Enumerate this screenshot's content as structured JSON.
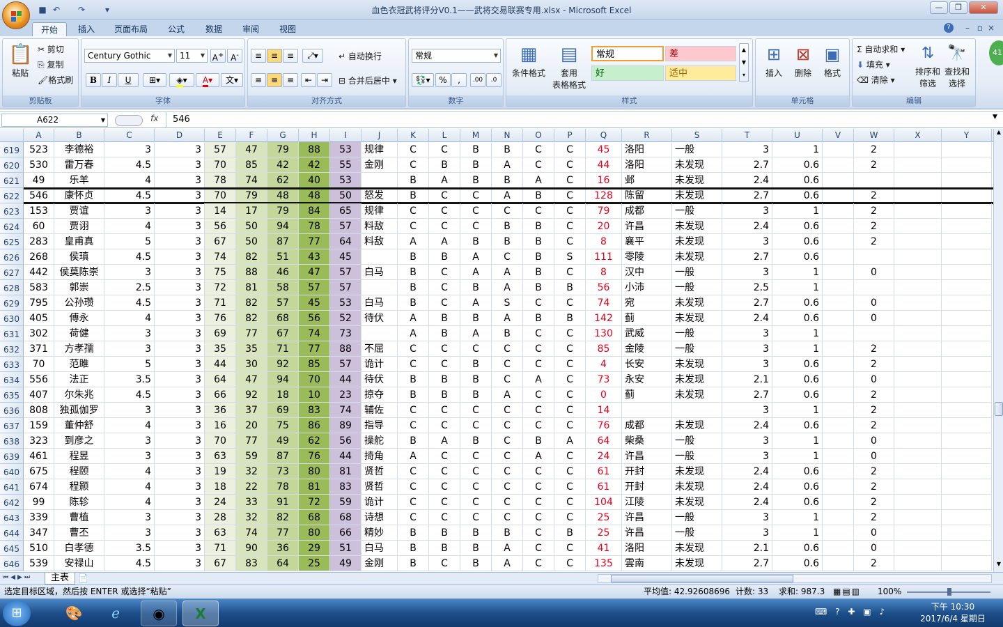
{
  "window": {
    "title": "血色衣冠武将评分V0.1——武将交易联赛专用.xlsx - Microsoft Excel"
  },
  "tabs": [
    "开始",
    "插入",
    "页面布局",
    "公式",
    "数据",
    "审阅",
    "视图"
  ],
  "ribbon": {
    "clipboard": {
      "paste": "粘贴",
      "cut": "剪切",
      "copy": "复制",
      "format_painter": "格式刷",
      "label": "剪贴板"
    },
    "font": {
      "name": "Century Gothic",
      "size": "11",
      "label": "字体",
      "bold": "B",
      "italic": "I",
      "underline": "U"
    },
    "alignment": {
      "wrap": "自动换行",
      "merge": "合并后居中",
      "label": "对齐方式"
    },
    "number": {
      "format": "常规",
      "percent": "%",
      "comma": ",",
      "label": "数字"
    },
    "styles": {
      "cond_format": "条件格式",
      "table_format_1": "套用",
      "table_format_2": "表格格式",
      "normal": "常规",
      "bad": "差",
      "good": "好",
      "neutral": "适中",
      "label": "样式"
    },
    "cells": {
      "insert": "插入",
      "delete": "删除",
      "format": "格式",
      "label": "单元格"
    },
    "editing": {
      "autosum": "自动求和",
      "fill": "填充",
      "clear": "清除",
      "sort_1": "排序和",
      "sort_2": "筛选",
      "find_1": "查找和",
      "find_2": "选择",
      "label": "编辑"
    }
  },
  "formula_bar": {
    "name_box": "A622",
    "fx": "fx",
    "value": "546"
  },
  "columns": [
    "A",
    "B",
    "C",
    "D",
    "E",
    "F",
    "G",
    "H",
    "I",
    "J",
    "K",
    "L",
    "M",
    "N",
    "O",
    "P",
    "Q",
    "R",
    "S",
    "T",
    "U",
    "V",
    "W",
    "X",
    "Y"
  ],
  "rows": [
    {
      "n": "619",
      "A": "523",
      "B": "李德裕",
      "C": "3",
      "D": "3",
      "E": "57",
      "F": "47",
      "G": "79",
      "H": "88",
      "I": "53",
      "J": "规律",
      "K": "C",
      "L": "C",
      "M": "B",
      "N": "B",
      "O": "C",
      "P": "C",
      "Q": "45",
      "R": "洛阳",
      "S": "一般",
      "T": "3",
      "U": "1",
      "W": "2"
    },
    {
      "n": "620",
      "A": "530",
      "B": "雷万春",
      "C": "4.5",
      "D": "3",
      "E": "70",
      "F": "85",
      "G": "42",
      "H": "42",
      "I": "55",
      "J": "金刚",
      "K": "C",
      "L": "B",
      "M": "B",
      "N": "A",
      "O": "C",
      "P": "C",
      "Q": "44",
      "R": "洛阳",
      "S": "未发现",
      "T": "2.7",
      "U": "0.6",
      "W": "2"
    },
    {
      "n": "621",
      "A": "49",
      "B": "乐羊",
      "C": "4",
      "D": "3",
      "E": "78",
      "F": "74",
      "G": "62",
      "H": "40",
      "I": "53",
      "J": "",
      "K": "B",
      "L": "A",
      "M": "B",
      "N": "B",
      "O": "A",
      "P": "C",
      "Q": "16",
      "R": "邺",
      "S": "未发现",
      "T": "2.4",
      "U": "0.6",
      "W": ""
    },
    {
      "n": "622",
      "A": "546",
      "B": "康怀贞",
      "C": "4.5",
      "D": "3",
      "E": "70",
      "F": "79",
      "G": "48",
      "H": "48",
      "I": "50",
      "J": "怒发",
      "K": "B",
      "L": "C",
      "M": "C",
      "N": "A",
      "O": "B",
      "P": "C",
      "Q": "128",
      "R": "陈留",
      "S": "未发现",
      "T": "2.7",
      "U": "0.6",
      "W": "2"
    },
    {
      "n": "623",
      "A": "153",
      "B": "贾谊",
      "C": "3",
      "D": "3",
      "E": "14",
      "F": "17",
      "G": "79",
      "H": "84",
      "I": "65",
      "J": "规律",
      "K": "C",
      "L": "C",
      "M": "C",
      "N": "C",
      "O": "C",
      "P": "C",
      "Q": "79",
      "R": "成都",
      "S": "一般",
      "T": "3",
      "U": "1",
      "W": "2"
    },
    {
      "n": "624",
      "A": "60",
      "B": "贾诩",
      "C": "4",
      "D": "3",
      "E": "56",
      "F": "50",
      "G": "94",
      "H": "78",
      "I": "57",
      "J": "料敌",
      "K": "C",
      "L": "C",
      "M": "C",
      "N": "B",
      "O": "B",
      "P": "C",
      "Q": "20",
      "R": "许昌",
      "S": "未发现",
      "T": "2.4",
      "U": "0.6",
      "W": "2"
    },
    {
      "n": "625",
      "A": "283",
      "B": "皇甫真",
      "C": "5",
      "D": "3",
      "E": "67",
      "F": "50",
      "G": "87",
      "H": "77",
      "I": "64",
      "J": "料敌",
      "K": "A",
      "L": "A",
      "M": "B",
      "N": "B",
      "O": "B",
      "P": "C",
      "Q": "8",
      "R": "襄平",
      "S": "未发现",
      "T": "3",
      "U": "0.6",
      "W": "2"
    },
    {
      "n": "626",
      "A": "268",
      "B": "侯瑱",
      "C": "4.5",
      "D": "3",
      "E": "74",
      "F": "82",
      "G": "51",
      "H": "43",
      "I": "45",
      "J": "",
      "K": "B",
      "L": "B",
      "M": "A",
      "N": "C",
      "O": "B",
      "P": "S",
      "Q": "111",
      "R": "零陵",
      "S": "未发现",
      "T": "2.7",
      "U": "0.6",
      "W": ""
    },
    {
      "n": "627",
      "A": "442",
      "B": "侯莫陈崇",
      "C": "3",
      "D": "3",
      "E": "75",
      "F": "88",
      "G": "46",
      "H": "47",
      "I": "57",
      "J": "白马",
      "K": "B",
      "L": "C",
      "M": "A",
      "N": "A",
      "O": "B",
      "P": "C",
      "Q": "8",
      "R": "汉中",
      "S": "一般",
      "T": "3",
      "U": "1",
      "W": "0"
    },
    {
      "n": "628",
      "A": "583",
      "B": "郭崇",
      "C": "2.5",
      "D": "3",
      "E": "72",
      "F": "81",
      "G": "58",
      "H": "57",
      "I": "57",
      "J": "",
      "K": "B",
      "L": "C",
      "M": "B",
      "N": "A",
      "O": "B",
      "P": "B",
      "Q": "56",
      "R": "小沛",
      "S": "一般",
      "T": "2.5",
      "U": "1",
      "W": ""
    },
    {
      "n": "629",
      "A": "795",
      "B": "公孙瓒",
      "C": "4.5",
      "D": "3",
      "E": "71",
      "F": "82",
      "G": "57",
      "H": "45",
      "I": "53",
      "J": "白马",
      "K": "B",
      "L": "C",
      "M": "A",
      "N": "S",
      "O": "C",
      "P": "C",
      "Q": "74",
      "R": "宛",
      "S": "未发现",
      "T": "2.7",
      "U": "0.6",
      "W": "0"
    },
    {
      "n": "630",
      "A": "405",
      "B": "傅永",
      "C": "4",
      "D": "3",
      "E": "76",
      "F": "82",
      "G": "68",
      "H": "56",
      "I": "52",
      "J": "待伏",
      "K": "A",
      "L": "B",
      "M": "B",
      "N": "A",
      "O": "B",
      "P": "B",
      "Q": "142",
      "R": "蓟",
      "S": "未发现",
      "T": "2.4",
      "U": "0.6",
      "W": "0"
    },
    {
      "n": "631",
      "A": "302",
      "B": "荷健",
      "C": "3",
      "D": "3",
      "E": "69",
      "F": "77",
      "G": "67",
      "H": "74",
      "I": "73",
      "J": "",
      "K": "A",
      "L": "B",
      "M": "A",
      "N": "B",
      "O": "C",
      "P": "C",
      "Q": "130",
      "R": "武威",
      "S": "一般",
      "T": "3",
      "U": "1",
      "W": ""
    },
    {
      "n": "632",
      "A": "371",
      "B": "方孝孺",
      "C": "3",
      "D": "3",
      "E": "35",
      "F": "35",
      "G": "71",
      "H": "77",
      "I": "88",
      "J": "不屈",
      "K": "C",
      "L": "C",
      "M": "C",
      "N": "C",
      "O": "C",
      "P": "C",
      "Q": "85",
      "R": "金陵",
      "S": "一般",
      "T": "3",
      "U": "1",
      "W": "2"
    },
    {
      "n": "633",
      "A": "70",
      "B": "范雎",
      "C": "5",
      "D": "3",
      "E": "44",
      "F": "30",
      "G": "92",
      "H": "85",
      "I": "57",
      "J": "诡计",
      "K": "C",
      "L": "C",
      "M": "B",
      "N": "C",
      "O": "C",
      "P": "C",
      "Q": "4",
      "R": "长安",
      "S": "未发现",
      "T": "3",
      "U": "0.6",
      "W": "2"
    },
    {
      "n": "634",
      "A": "556",
      "B": "法正",
      "C": "3.5",
      "D": "3",
      "E": "64",
      "F": "47",
      "G": "94",
      "H": "70",
      "I": "44",
      "J": "待伏",
      "K": "B",
      "L": "B",
      "M": "B",
      "N": "C",
      "O": "A",
      "P": "C",
      "Q": "73",
      "R": "永安",
      "S": "未发现",
      "T": "2.1",
      "U": "0.6",
      "W": "0"
    },
    {
      "n": "635",
      "A": "407",
      "B": "尔朱兆",
      "C": "4.5",
      "D": "3",
      "E": "66",
      "F": "92",
      "G": "18",
      "H": "10",
      "I": "23",
      "J": "掠夺",
      "K": "B",
      "L": "B",
      "M": "B",
      "N": "A",
      "O": "C",
      "P": "C",
      "Q": "0",
      "R": "蓟",
      "S": "未发现",
      "T": "2.7",
      "U": "0.6",
      "W": "2"
    },
    {
      "n": "636",
      "A": "808",
      "B": "独孤伽罗",
      "C": "3",
      "D": "3",
      "E": "36",
      "F": "37",
      "G": "69",
      "H": "83",
      "I": "74",
      "J": "辅佐",
      "K": "C",
      "L": "C",
      "M": "C",
      "N": "C",
      "O": "C",
      "P": "C",
      "Q": "14",
      "R": "",
      "S": "",
      "T": "3",
      "U": "1",
      "W": "2"
    },
    {
      "n": "637",
      "A": "159",
      "B": "董仲舒",
      "C": "4",
      "D": "3",
      "E": "16",
      "F": "20",
      "G": "75",
      "H": "86",
      "I": "89",
      "J": "指导",
      "K": "C",
      "L": "C",
      "M": "C",
      "N": "C",
      "O": "C",
      "P": "C",
      "Q": "76",
      "R": "成都",
      "S": "未发现",
      "T": "2.4",
      "U": "0.6",
      "W": "2"
    },
    {
      "n": "638",
      "A": "323",
      "B": "到彦之",
      "C": "3",
      "D": "3",
      "E": "70",
      "F": "77",
      "G": "49",
      "H": "62",
      "I": "56",
      "J": "操舵",
      "K": "B",
      "L": "A",
      "M": "B",
      "N": "C",
      "O": "B",
      "P": "A",
      "Q": "64",
      "R": "柴桑",
      "S": "一般",
      "T": "3",
      "U": "1",
      "W": "0"
    },
    {
      "n": "639",
      "A": "461",
      "B": "程昱",
      "C": "3",
      "D": "3",
      "E": "63",
      "F": "59",
      "G": "87",
      "H": "76",
      "I": "44",
      "J": "掎角",
      "K": "A",
      "L": "C",
      "M": "C",
      "N": "C",
      "O": "A",
      "P": "C",
      "Q": "24",
      "R": "许昌",
      "S": "一般",
      "T": "3",
      "U": "1",
      "W": "0"
    },
    {
      "n": "640",
      "A": "675",
      "B": "程颐",
      "C": "4",
      "D": "3",
      "E": "19",
      "F": "32",
      "G": "73",
      "H": "80",
      "I": "81",
      "J": "贤哲",
      "K": "C",
      "L": "C",
      "M": "C",
      "N": "C",
      "O": "C",
      "P": "C",
      "Q": "61",
      "R": "开封",
      "S": "未发现",
      "T": "2.4",
      "U": "0.6",
      "W": "2"
    },
    {
      "n": "641",
      "A": "674",
      "B": "程颢",
      "C": "4",
      "D": "3",
      "E": "18",
      "F": "22",
      "G": "78",
      "H": "81",
      "I": "83",
      "J": "贤哲",
      "K": "C",
      "L": "C",
      "M": "C",
      "N": "C",
      "O": "C",
      "P": "C",
      "Q": "61",
      "R": "开封",
      "S": "未发现",
      "T": "2.4",
      "U": "0.6",
      "W": "2"
    },
    {
      "n": "642",
      "A": "99",
      "B": "陈轸",
      "C": "4",
      "D": "3",
      "E": "24",
      "F": "33",
      "G": "91",
      "H": "72",
      "I": "59",
      "J": "诡计",
      "K": "C",
      "L": "C",
      "M": "C",
      "N": "C",
      "O": "C",
      "P": "C",
      "Q": "104",
      "R": "江陵",
      "S": "未发现",
      "T": "2.4",
      "U": "0.6",
      "W": "2"
    },
    {
      "n": "643",
      "A": "339",
      "B": "曹植",
      "C": "3",
      "D": "3",
      "E": "28",
      "F": "32",
      "G": "82",
      "H": "68",
      "I": "68",
      "J": "诗想",
      "K": "C",
      "L": "C",
      "M": "C",
      "N": "C",
      "O": "C",
      "P": "C",
      "Q": "25",
      "R": "许昌",
      "S": "一般",
      "T": "3",
      "U": "1",
      "W": "2"
    },
    {
      "n": "644",
      "A": "347",
      "B": "曹丕",
      "C": "3",
      "D": "3",
      "E": "63",
      "F": "74",
      "G": "77",
      "H": "80",
      "I": "66",
      "J": "精妙",
      "K": "B",
      "L": "B",
      "M": "B",
      "N": "B",
      "O": "C",
      "P": "B",
      "Q": "25",
      "R": "许昌",
      "S": "一般",
      "T": "3",
      "U": "1",
      "W": "0"
    },
    {
      "n": "645",
      "A": "510",
      "B": "白孝德",
      "C": "3.5",
      "D": "3",
      "E": "71",
      "F": "90",
      "G": "36",
      "H": "29",
      "I": "51",
      "J": "白马",
      "K": "B",
      "L": "B",
      "M": "B",
      "N": "A",
      "O": "C",
      "P": "C",
      "Q": "41",
      "R": "洛阳",
      "S": "未发现",
      "T": "2.1",
      "U": "0.6",
      "W": "0"
    },
    {
      "n": "646",
      "A": "539",
      "B": "安禄山",
      "C": "4.5",
      "D": "3",
      "E": "67",
      "F": "83",
      "G": "64",
      "H": "25",
      "I": "49",
      "J": "金刚",
      "K": "B",
      "L": "C",
      "M": "B",
      "N": "A",
      "O": "C",
      "P": "C",
      "Q": "135",
      "R": "雲南",
      "S": "未发现",
      "T": "2.7",
      "U": "0.6",
      "W": "2"
    }
  ],
  "sheet_tab": "主表",
  "status": {
    "message": "选定目标区域，然后按 ENTER 或选择“粘贴”",
    "average": "平均值: 42.92608696",
    "count": "计数: 33",
    "sum": "求和: 987.3",
    "zoom": "100%"
  },
  "taskbar": {
    "time": "下午 10:30",
    "date": "2017/6/4 星期日"
  },
  "colors": {
    "E": "#ebf1de",
    "F": "#d8e4bc",
    "G": "#c4d79b",
    "H": "#9bbb59",
    "I": "#ccc0da",
    "red": "#e8001c"
  }
}
